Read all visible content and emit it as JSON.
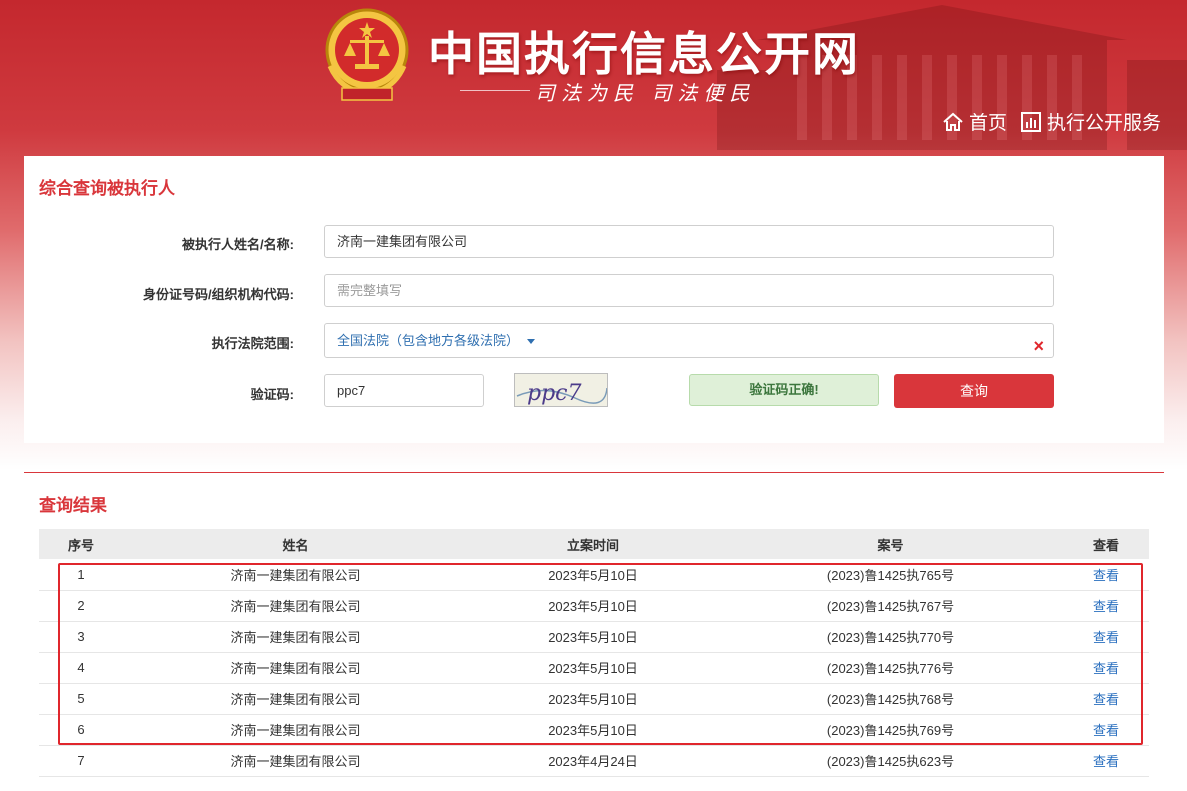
{
  "header": {
    "site_title": "中国执行信息公开网",
    "slogan": "司法为民  司法便民",
    "nav": {
      "home_label": "首页",
      "service_label": "执行公开服务"
    }
  },
  "query_panel": {
    "title": "综合查询被执行人",
    "name_label": "被执行人姓名/名称:",
    "name_value": "济南一建集团有限公司",
    "id_label": "身份证号码/组织机构代码:",
    "id_placeholder": "需完整填写",
    "court_label": "执行法院范围:",
    "court_value": "全国法院（包含地方各级法院）",
    "captcha_label": "验证码:",
    "captcha_value": "ppc7",
    "captcha_image_text": "ppc7",
    "captcha_status": "验证码正确!",
    "query_button": "查询"
  },
  "results": {
    "title": "查询结果",
    "columns": [
      "序号",
      "姓名",
      "立案时间",
      "案号",
      "查看"
    ],
    "rows": [
      {
        "no": "1",
        "name": "济南一建集团有限公司",
        "date": "2023年5月10日",
        "case_no": "(2023)鲁1425执765号",
        "view": "查看"
      },
      {
        "no": "2",
        "name": "济南一建集团有限公司",
        "date": "2023年5月10日",
        "case_no": "(2023)鲁1425执767号",
        "view": "查看"
      },
      {
        "no": "3",
        "name": "济南一建集团有限公司",
        "date": "2023年5月10日",
        "case_no": "(2023)鲁1425执770号",
        "view": "查看"
      },
      {
        "no": "4",
        "name": "济南一建集团有限公司",
        "date": "2023年5月10日",
        "case_no": "(2023)鲁1425执776号",
        "view": "查看"
      },
      {
        "no": "5",
        "name": "济南一建集团有限公司",
        "date": "2023年5月10日",
        "case_no": "(2023)鲁1425执768号",
        "view": "查看"
      },
      {
        "no": "6",
        "name": "济南一建集团有限公司",
        "date": "2023年5月10日",
        "case_no": "(2023)鲁1425执769号",
        "view": "查看"
      },
      {
        "no": "7",
        "name": "济南一建集团有限公司",
        "date": "2023年4月24日",
        "case_no": "(2023)鲁1425执623号",
        "view": "查看"
      }
    ]
  },
  "colors": {
    "brand_red": "#d9363b",
    "link_blue": "#2a6fbf",
    "success_green": "#3c763d"
  }
}
